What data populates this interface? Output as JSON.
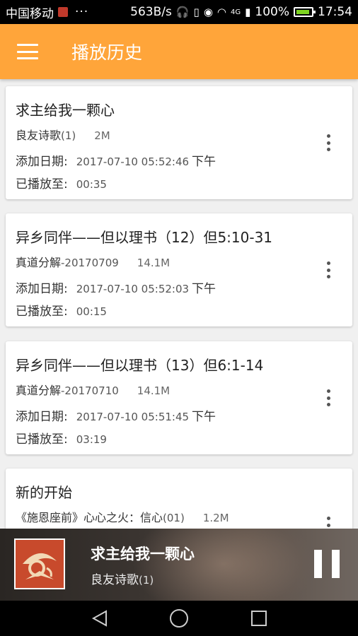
{
  "status_bar": {
    "carrier": "中国移动",
    "dots": "···",
    "speed": "563B/s",
    "network": "4G",
    "battery": "100%",
    "time": "17:54"
  },
  "app_bar": {
    "menu_icon": "menu-icon",
    "title": "播放历史"
  },
  "labels": {
    "added_date": "添加日期:",
    "played_to": "已播放至:"
  },
  "items": [
    {
      "title": "求主给我一颗心",
      "album": "良友诗歌",
      "album_sub": "(1)",
      "size": "2M",
      "date": "2017-07-10 05:52:46",
      "ampm": "下午",
      "position": "00:35"
    },
    {
      "title": "异乡同伴——但以理书（12）但5:10-31",
      "album": "真道分解",
      "album_sub": "-20170709",
      "size": "14.1M",
      "date": "2017-07-10 05:52:03",
      "ampm": "下午",
      "position": "00:15"
    },
    {
      "title": "异乡同伴——但以理书（13）但6:1-14",
      "album": "真道分解",
      "album_sub": "-20170710",
      "size": "14.1M",
      "date": "2017-07-10 05:51:45",
      "ampm": "下午",
      "position": "03:19"
    },
    {
      "title": "新的开始",
      "album": "《施恩座前》心心之火：信心",
      "album_sub": "(01)",
      "size": "1.2M",
      "date": "",
      "ampm": "",
      "position": ""
    }
  ],
  "player": {
    "title": "求主给我一颗心",
    "album": "良友诗歌",
    "album_sub": "(1)",
    "state_icon": "pause-icon"
  },
  "colors": {
    "accent": "#ffa53a",
    "status_bar": "#000000",
    "card": "#ffffff",
    "background": "#f0f0f0"
  }
}
